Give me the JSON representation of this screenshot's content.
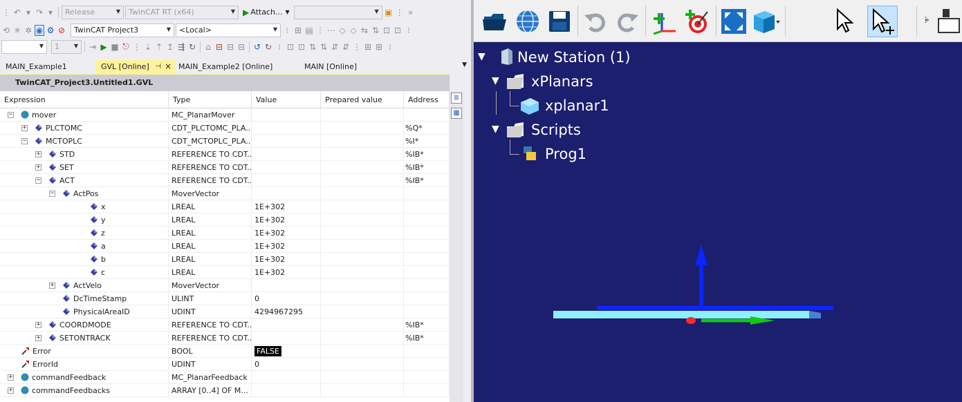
{
  "toolbar1": {
    "config": "Release",
    "platform": "TwinCAT RT (x64)",
    "attach_label": "Attach..."
  },
  "toolbar2": {
    "project": "TwinCAT Project3",
    "target": "<Local>"
  },
  "toolbar3": {
    "instance": "1"
  },
  "tabs": [
    "MAIN_Example1",
    "GVL [Online]",
    "MAIN_Example2 [Online]",
    "MAIN [Online]"
  ],
  "window_title": "TwinCAT_Project3.Untitled1.GVL",
  "columns": [
    "Expression",
    "Type",
    "Value",
    "Prepared value",
    "Address"
  ],
  "rows": [
    {
      "name": "mover",
      "type": "MC_PlanarMover",
      "value": "",
      "address": ""
    },
    {
      "name": "PLCTOMC",
      "type": "CDT_PLCTOMC_PLA...",
      "value": "",
      "address": "%Q*"
    },
    {
      "name": "MCTOPLC",
      "type": "CDT_MCTOPLC_PLA...",
      "value": "",
      "address": "%I*"
    },
    {
      "name": "STD",
      "type": "REFERENCE TO CDT...",
      "value": "",
      "address": "%IB*"
    },
    {
      "name": "SET",
      "type": "REFERENCE TO CDT...",
      "value": "",
      "address": "%IB*"
    },
    {
      "name": "ACT",
      "type": "REFERENCE TO CDT...",
      "value": "",
      "address": "%IB*"
    },
    {
      "name": "ActPos",
      "type": "MoverVector",
      "value": "",
      "address": ""
    },
    {
      "name": "x",
      "type": "LREAL",
      "value": "1E+302",
      "address": ""
    },
    {
      "name": "y",
      "type": "LREAL",
      "value": "1E+302",
      "address": ""
    },
    {
      "name": "z",
      "type": "LREAL",
      "value": "1E+302",
      "address": ""
    },
    {
      "name": "a",
      "type": "LREAL",
      "value": "1E+302",
      "address": ""
    },
    {
      "name": "b",
      "type": "LREAL",
      "value": "1E+302",
      "address": ""
    },
    {
      "name": "c",
      "type": "LREAL",
      "value": "1E+302",
      "address": ""
    },
    {
      "name": "ActVelo",
      "type": "MoverVector",
      "value": "",
      "address": ""
    },
    {
      "name": "DcTimeStamp",
      "type": "ULINT",
      "value": "0",
      "address": ""
    },
    {
      "name": "PhysicalAreaID",
      "type": "UDINT",
      "value": "4294967295",
      "address": ""
    },
    {
      "name": "COORDMODE",
      "type": "REFERENCE TO CDT...",
      "value": "",
      "address": "%IB*"
    },
    {
      "name": "SETONTRACK",
      "type": "REFERENCE TO CDT...",
      "value": "",
      "address": "%IB*"
    },
    {
      "name": "Error",
      "type": "BOOL",
      "value": "FALSE",
      "address": ""
    },
    {
      "name": "ErrorId",
      "type": "UDINT",
      "value": "0",
      "address": ""
    },
    {
      "name": "commandFeedback",
      "type": "MC_PlanarFeedback",
      "value": "",
      "address": ""
    },
    {
      "name": "commandFeedbacks",
      "type": "ARRAY [0..4] OF M...",
      "value": "",
      "address": ""
    }
  ],
  "tree": [
    {
      "label": "New Station (1)"
    },
    {
      "label": "xPlanars"
    },
    {
      "label": "xplanar1"
    },
    {
      "label": "Scripts"
    },
    {
      "label": "Prog1"
    }
  ],
  "colors": {
    "active_tab": "#fff29d",
    "scene_bg": "#1c1e6e",
    "z_axis": "#0a25ff",
    "x_axis": "#ff2a2a",
    "y_axis": "#14c814",
    "tile": "#8cf0ff"
  }
}
